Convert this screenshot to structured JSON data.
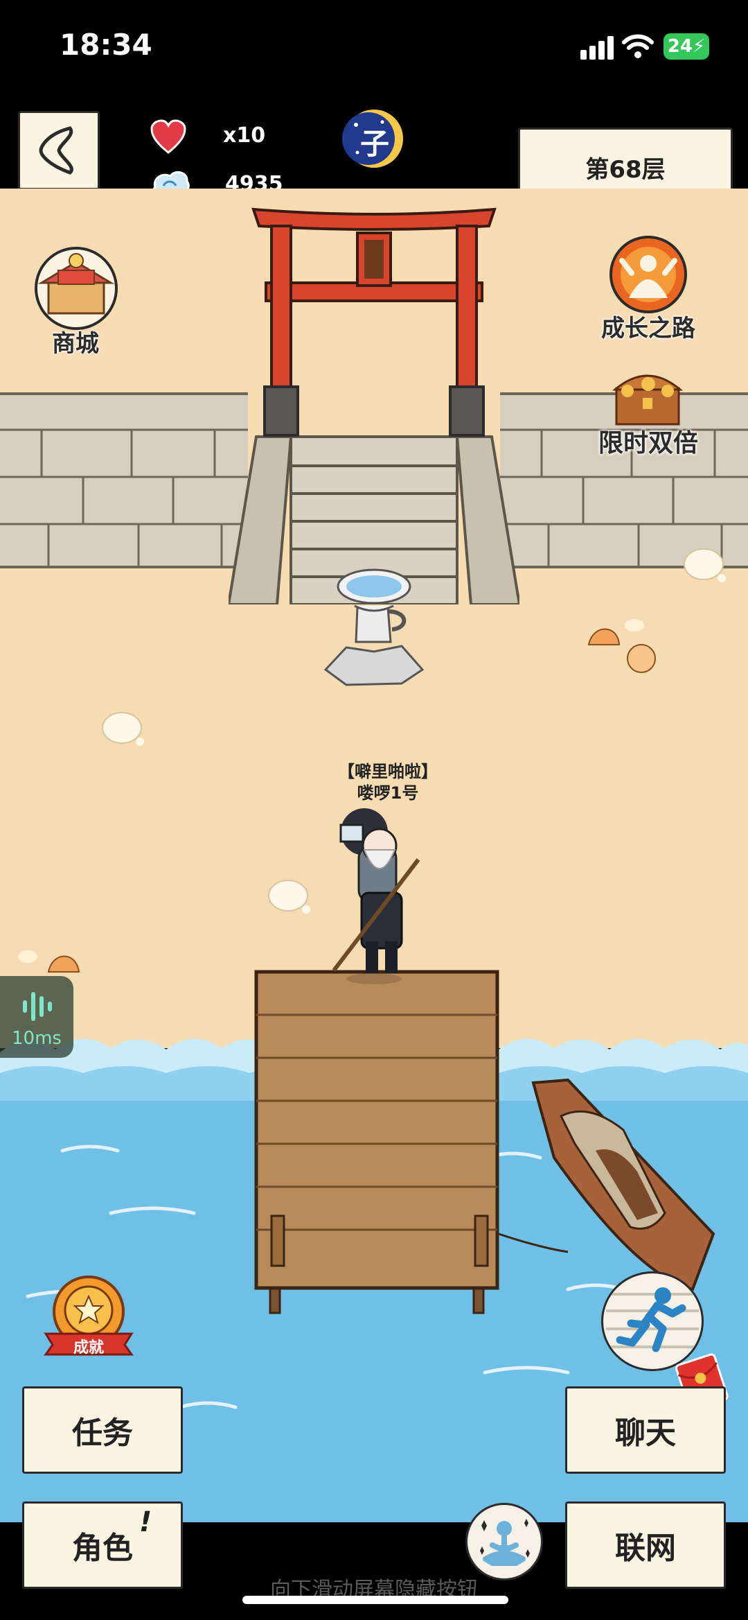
{
  "status": {
    "time": "18:34",
    "battery": "24"
  },
  "hud": {
    "lives": "x10",
    "currency": "4935",
    "time_icon_char": "子",
    "floor": "第68层"
  },
  "side_buttons": {
    "shop": "商城",
    "growth": "成长之路",
    "double": "限时双倍",
    "achievement_badge": "成就"
  },
  "player": {
    "name_line1": "【噼里啪啦】",
    "name_line2": "喽啰1号"
  },
  "latency": "10ms",
  "menu": {
    "tasks": "任务",
    "chat": "聊天",
    "character": "角色",
    "network": "联网"
  },
  "hint": "向下滑动屏幕隐藏按钮",
  "colors": {
    "sand": "#f6dcb2",
    "sea": "#6fbfe7",
    "torii": "#d8452e",
    "button_bg": "#fbf4e2"
  },
  "icons": [
    "back-chevron-icon",
    "heart-icon",
    "cloud-icon",
    "moon-time-icon",
    "shop-icon",
    "growth-path-icon",
    "treasure-chest-icon",
    "achievement-icon",
    "run-icon",
    "red-envelope-icon",
    "meditate-icon",
    "audio-wave-icon"
  ]
}
